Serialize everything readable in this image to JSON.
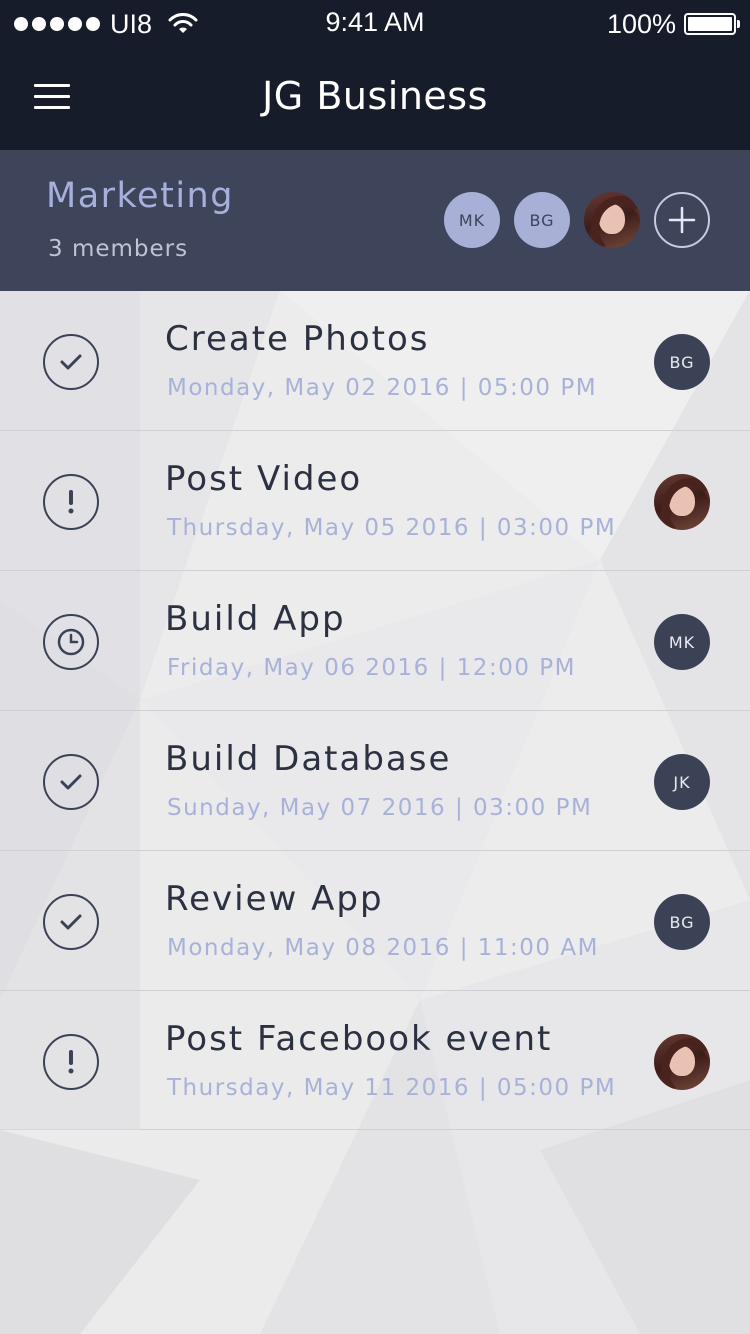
{
  "status_bar": {
    "carrier": "UI8",
    "time": "9:41 AM",
    "battery": "100%"
  },
  "nav": {
    "title": "JG Business",
    "menu_icon": "hamburger-menu-icon"
  },
  "group": {
    "name": "Marketing",
    "members_label": "3 members",
    "members": [
      {
        "initials": "MK",
        "type": "initials"
      },
      {
        "initials": "BG",
        "type": "initials"
      },
      {
        "initials": "",
        "type": "photo"
      }
    ],
    "add_icon": "plus-icon"
  },
  "tasks": [
    {
      "title": "Create Photos",
      "date": "Monday, May 02 2016 | 05:00 PM",
      "status": "check-icon",
      "assignee": "BG",
      "assignee_type": "initials"
    },
    {
      "title": "Post Video",
      "date": "Thursday, May 05 2016 | 03:00 PM",
      "status": "exclamation-icon",
      "assignee": "",
      "assignee_type": "photo"
    },
    {
      "title": "Build App",
      "date": "Friday, May 06 2016 | 12:00 PM",
      "status": "clock-icon",
      "assignee": "MK",
      "assignee_type": "initials"
    },
    {
      "title": "Build Database",
      "date": "Sunday, May 07 2016 | 03:00 PM",
      "status": "check-icon",
      "assignee": "JK",
      "assignee_type": "initials"
    },
    {
      "title": "Review App",
      "date": "Monday, May 08 2016 | 11:00 AM",
      "status": "check-icon",
      "assignee": "BG",
      "assignee_type": "initials"
    },
    {
      "title": "Post Facebook event",
      "date": "Thursday, May 11 2016 | 05:00 PM",
      "status": "exclamation-icon",
      "assignee": "",
      "assignee_type": "photo"
    }
  ],
  "colors": {
    "navbar": "#171c2a",
    "group_header": "#3e4459",
    "accent": "#a8b0d8",
    "title_text": "#2c3142",
    "date_text": "#a8b2d8"
  }
}
